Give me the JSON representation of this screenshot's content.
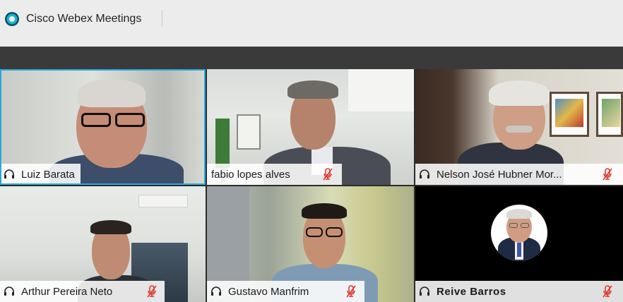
{
  "app": {
    "title": "Cisco Webex Meetings",
    "accent_color": "#29a8e0"
  },
  "participants": [
    {
      "name": "Luiz Barata",
      "icon_left": "headset-icon",
      "muted": false,
      "active_speaker": true
    },
    {
      "name": "fabio lopes alves",
      "icon_left": null,
      "muted": true,
      "active_speaker": false
    },
    {
      "name": "Nelson José Hubner Mor...",
      "icon_left": "headset-icon",
      "muted": true,
      "active_speaker": false
    },
    {
      "name": "Arthur Pereira Neto",
      "icon_left": "headset-icon",
      "muted": true,
      "active_speaker": false
    },
    {
      "name": "Gustavo Manfrim",
      "icon_left": "headset-icon",
      "muted": true,
      "active_speaker": false
    },
    {
      "name": "Reive Barros",
      "icon_left": "headset-icon",
      "muted": true,
      "active_speaker": false,
      "video_off": true
    }
  ],
  "colors": {
    "mute_icon": "#e0312b",
    "toolbar": "#3a3a3a"
  }
}
